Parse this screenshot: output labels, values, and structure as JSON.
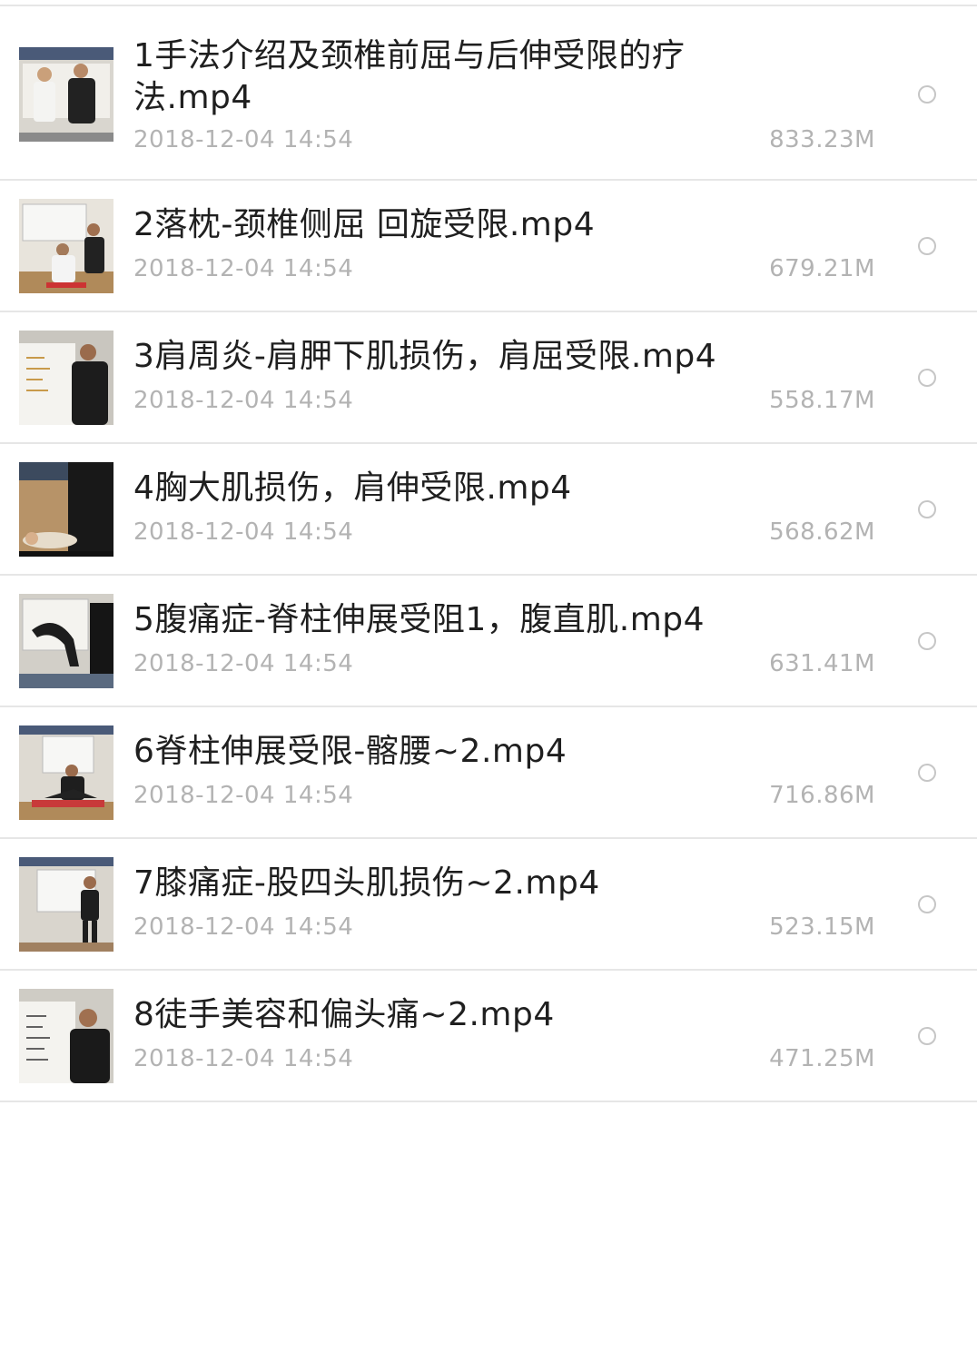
{
  "files": [
    {
      "name": "1手法介绍及颈椎前屈与后伸受限的疗法.mp4",
      "date": "2018-12-04 14:54",
      "size": "833.23M",
      "thumbnail_icon": "video-thumbnail-icon"
    },
    {
      "name": "2落枕-颈椎侧屈 回旋受限.mp4",
      "date": "2018-12-04 14:54",
      "size": "679.21M",
      "thumbnail_icon": "video-thumbnail-icon"
    },
    {
      "name": "3肩周炎-肩胛下肌损伤，肩屈受限.mp4",
      "date": "2018-12-04 14:54",
      "size": "558.17M",
      "thumbnail_icon": "video-thumbnail-icon"
    },
    {
      "name": "4胸大肌损伤，肩伸受限.mp4",
      "date": "2018-12-04 14:54",
      "size": "568.62M",
      "thumbnail_icon": "video-thumbnail-icon"
    },
    {
      "name": "5腹痛症-脊柱伸展受阻1，腹直肌.mp4",
      "date": "2018-12-04 14:54",
      "size": "631.41M",
      "thumbnail_icon": "video-thumbnail-icon"
    },
    {
      "name": "6脊柱伸展受限-髂腰~2.mp4",
      "date": "2018-12-04 14:54",
      "size": "716.86M",
      "thumbnail_icon": "video-thumbnail-icon"
    },
    {
      "name": "7膝痛症-股四头肌损伤~2.mp4",
      "date": "2018-12-04 14:54",
      "size": "523.15M",
      "thumbnail_icon": "video-thumbnail-icon"
    },
    {
      "name": "8徒手美容和偏头痛~2.mp4",
      "date": "2018-12-04 14:54",
      "size": "471.25M",
      "thumbnail_icon": "video-thumbnail-icon"
    }
  ],
  "colors": {
    "title_text": "#1f1f1f",
    "meta_text": "#b3b3b3",
    "divider": "#e6e6e6",
    "radio_border": "#c6c6c6"
  }
}
